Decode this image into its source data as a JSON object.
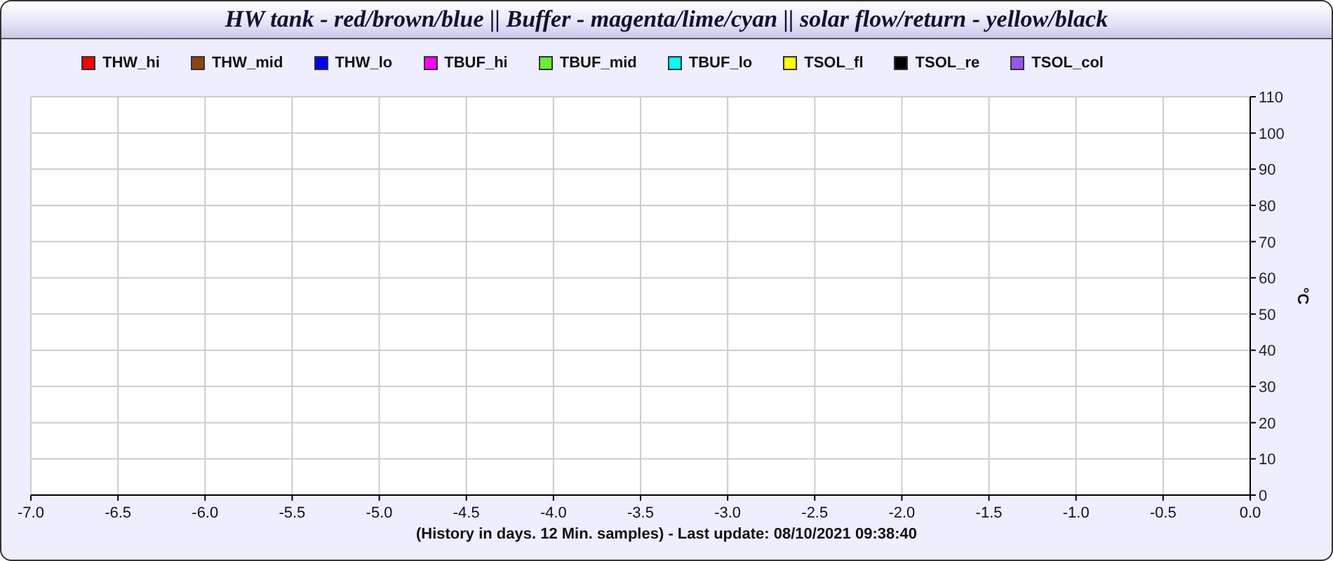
{
  "title": "HW tank - red/brown/blue || Buffer - magenta/lime/cyan || solar flow/return - yellow/black",
  "chart": {
    "chart_data": {
      "type": "line",
      "ylabel": "°C",
      "ylim": [
        0,
        110
      ],
      "categories": [
        "-7.0",
        "-6.5",
        "-6.0",
        "-5.5",
        "-5.0",
        "-4.5",
        "-4.0",
        "-3.5",
        "-3.0",
        "-2.5",
        "-2.0",
        "-1.5",
        "-1.0",
        "-0.5",
        "0.0"
      ],
      "yticks": [
        0,
        10,
        20,
        30,
        40,
        50,
        60,
        70,
        80,
        90,
        100,
        110
      ],
      "grid": true,
      "series": [
        {
          "name": "THW_hi",
          "color": "#ff0000",
          "values": [
            null,
            null,
            null,
            null,
            null,
            null,
            null,
            null,
            null,
            null,
            null,
            null,
            null,
            null,
            null
          ]
        },
        {
          "name": "THW_mid",
          "color": "#8b4513",
          "values": [
            null,
            null,
            null,
            null,
            null,
            null,
            null,
            null,
            null,
            null,
            null,
            null,
            null,
            null,
            null
          ]
        },
        {
          "name": "THW_lo",
          "color": "#0000ff",
          "values": [
            null,
            null,
            null,
            null,
            null,
            null,
            null,
            null,
            null,
            null,
            null,
            null,
            null,
            null,
            null
          ]
        },
        {
          "name": "TBUF_hi",
          "color": "#ff00ff",
          "values": [
            null,
            null,
            null,
            null,
            null,
            null,
            null,
            null,
            null,
            null,
            null,
            null,
            null,
            null,
            null
          ]
        },
        {
          "name": "TBUF_mid",
          "color": "#66ee33",
          "values": [
            null,
            null,
            null,
            null,
            null,
            null,
            null,
            null,
            null,
            null,
            null,
            null,
            null,
            null,
            null
          ]
        },
        {
          "name": "TBUF_lo",
          "color": "#00ffff",
          "values": [
            null,
            null,
            null,
            null,
            null,
            null,
            null,
            null,
            null,
            null,
            null,
            null,
            null,
            null,
            null
          ]
        },
        {
          "name": "TSOL_fl",
          "color": "#ffff00",
          "values": [
            null,
            null,
            null,
            null,
            null,
            null,
            null,
            null,
            null,
            null,
            null,
            null,
            null,
            null,
            null
          ]
        },
        {
          "name": "TSOL_re",
          "color": "#000000",
          "values": [
            null,
            null,
            null,
            null,
            null,
            null,
            null,
            null,
            null,
            null,
            null,
            null,
            null,
            null,
            null
          ]
        },
        {
          "name": "TSOL_col",
          "color": "#9955ee",
          "values": [
            null,
            null,
            null,
            null,
            null,
            null,
            null,
            null,
            null,
            null,
            null,
            null,
            null,
            null,
            null
          ]
        }
      ]
    },
    "footnote": "(History in days. 12 Min. samples) - Last update: 08/10/2021 09:38:40"
  }
}
